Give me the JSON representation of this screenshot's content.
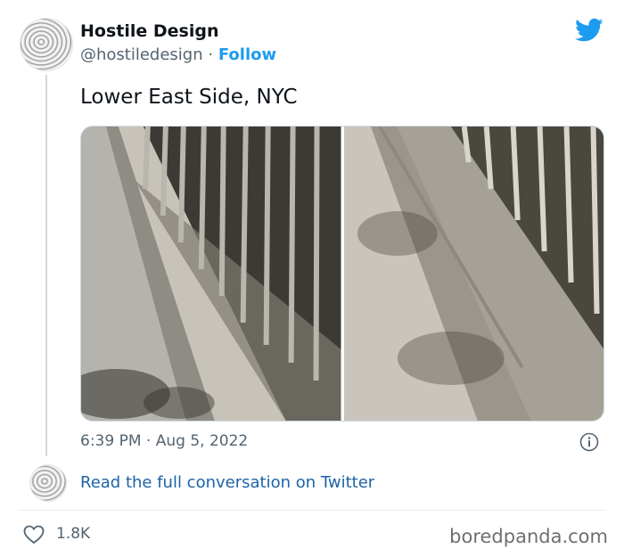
{
  "tweet": {
    "author_name": "Hostile Design",
    "handle": "@hostiledesign",
    "separator": "·",
    "follow_label": "Follow",
    "text": "Lower East Side, NYC",
    "time": "6:39 PM",
    "date": "Aug 5, 2022"
  },
  "thread": {
    "read_more": "Read the full conversation on Twitter"
  },
  "actions": {
    "like_count": "1.8K"
  },
  "watermark": "boredpanda.com",
  "icons": {
    "brand": "twitter-bird-icon",
    "info": "info-icon",
    "like": "heart-icon"
  },
  "colors": {
    "accent": "#1d9bf0",
    "link": "#1d63a8",
    "muted": "#536471"
  }
}
